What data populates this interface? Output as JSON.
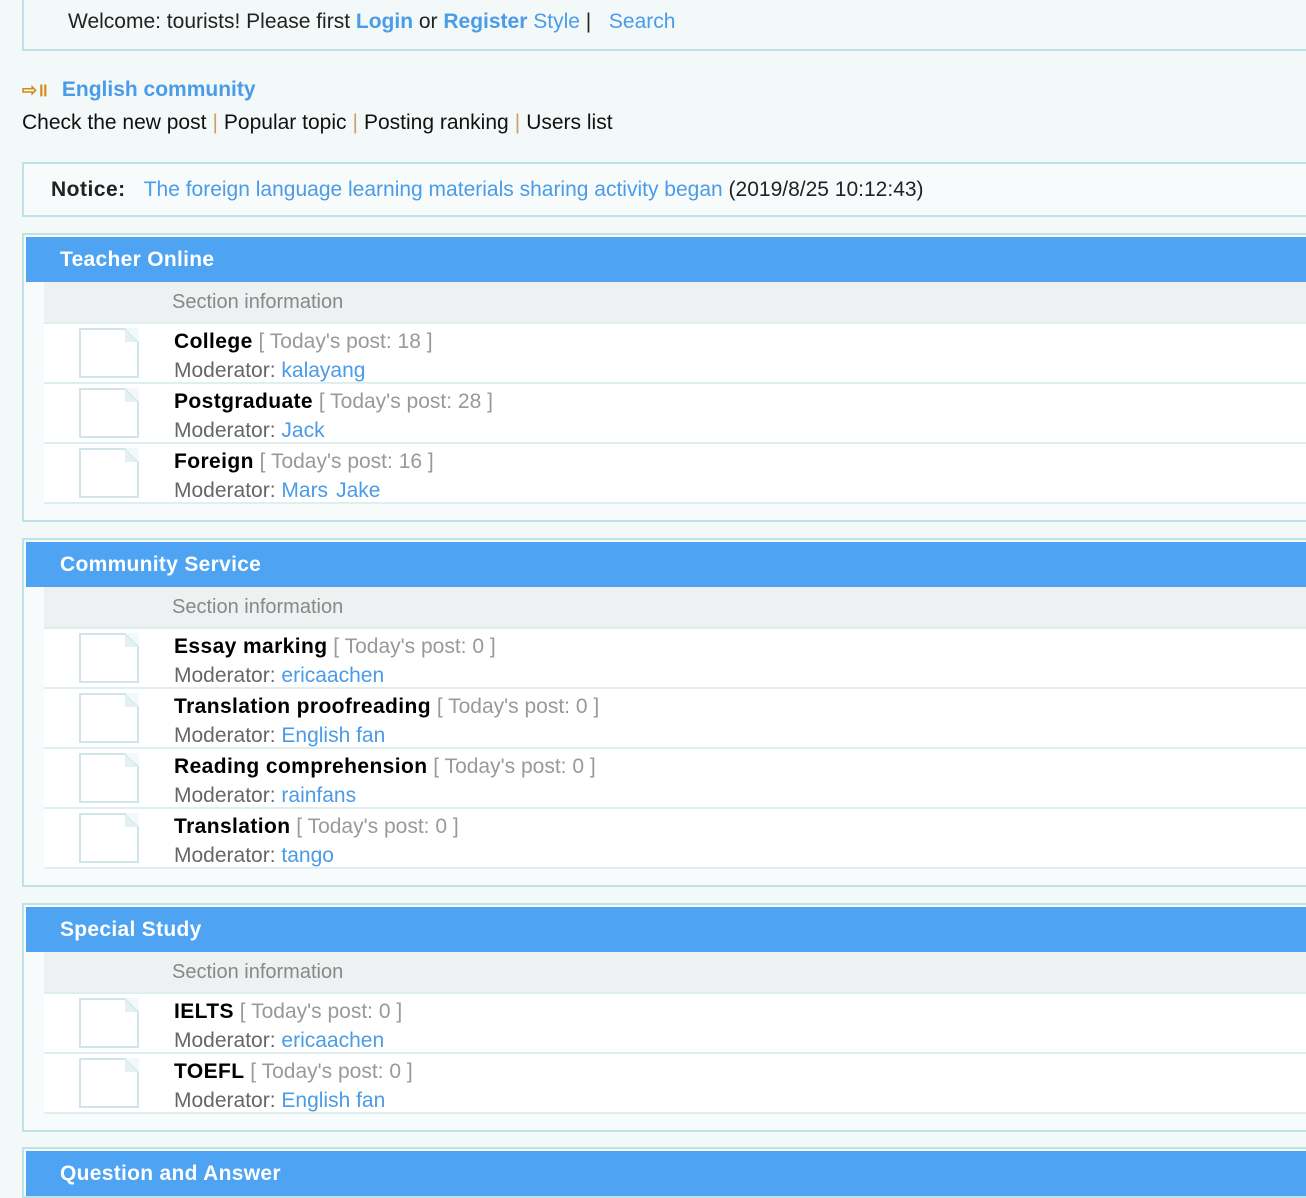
{
  "topbar": {
    "welcome": "Welcome: tourists! Please first ",
    "login": "Login",
    "or": " or ",
    "register": "Register",
    "style": " Style",
    "sep": " |  ",
    "search": "Search"
  },
  "nav": {
    "title": "English community",
    "icon": "arrow-icon",
    "links": [
      "Check the new post",
      "Popular topic",
      "Posting ranking",
      "Users list"
    ]
  },
  "notice": {
    "label": "Notice:",
    "text": "The foreign language learning materials sharing activity began",
    "time": " (2019/8/25 10:12:43)"
  },
  "section_info_label": "Section information",
  "todays_post_label": "Today's post: ",
  "moderator_label": "Moderator: ",
  "sections": [
    {
      "title": "Teacher Online",
      "forums": [
        {
          "name": "College",
          "count": "18",
          "mods": [
            "kalayang"
          ]
        },
        {
          "name": "Postgraduate",
          "count": "28",
          "mods": [
            "Jack"
          ]
        },
        {
          "name": "Foreign",
          "count": "16",
          "mods": [
            "Mars",
            "Jake"
          ]
        }
      ]
    },
    {
      "title": "Community Service",
      "forums": [
        {
          "name": "Essay marking",
          "count": "0",
          "mods": [
            "ericaachen"
          ]
        },
        {
          "name": "Translation proofreading",
          "count": "0",
          "mods": [
            "English fan"
          ]
        },
        {
          "name": "Reading comprehension",
          "count": "0",
          "mods": [
            "rainfans"
          ]
        },
        {
          "name": "Translation",
          "count": "0",
          "mods": [
            "tango"
          ]
        }
      ]
    },
    {
      "title": "Special Study",
      "forums": [
        {
          "name": "IELTS",
          "count": "0",
          "mods": [
            "ericaachen"
          ]
        },
        {
          "name": "TOEFL",
          "count": "0",
          "mods": [
            "English fan"
          ]
        }
      ]
    },
    {
      "title": "Question and Answer",
      "forums": []
    }
  ]
}
